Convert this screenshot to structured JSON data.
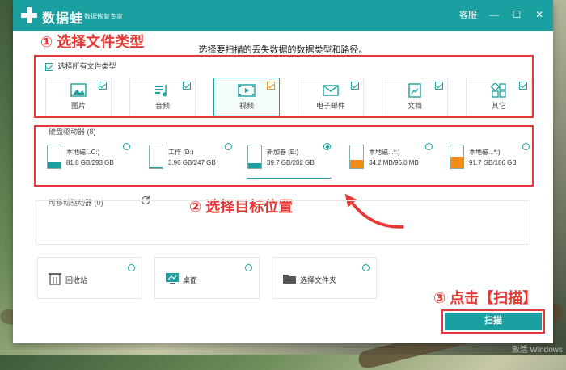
{
  "app": {
    "name": "数据蛙",
    "subtitle": "数据恢复专家"
  },
  "titlebar": {
    "service": "客服",
    "minimize": "—",
    "maximize": "☐",
    "close": "✕"
  },
  "annotations": {
    "step1": "① 选择文件类型",
    "step2": "② 选择目标位置",
    "step3": "③ 点击【扫描】"
  },
  "instruction": "选择要扫描的丢失数据的数据类型和路径。",
  "file_types": {
    "select_all_label": "选择所有文件类型",
    "items": [
      {
        "label": "图片",
        "icon": "image-icon",
        "checked": true
      },
      {
        "label": "音频",
        "icon": "audio-icon",
        "checked": true
      },
      {
        "label": "视频",
        "icon": "video-icon",
        "checked": true,
        "selected": true
      },
      {
        "label": "电子邮件",
        "icon": "email-icon",
        "checked": true
      },
      {
        "label": "文档",
        "icon": "document-icon",
        "checked": true
      },
      {
        "label": "其它",
        "icon": "other-icon",
        "checked": true
      }
    ]
  },
  "hard_drives": {
    "title": "硬盘驱动器 (8)",
    "items": [
      {
        "name": "本地磁...C:)",
        "size": "81.8 GB/293 GB",
        "fill": 0.28,
        "color": "#1aa0a0",
        "selected": false
      },
      {
        "name": "工作 (D:)",
        "size": "3.96 GB/247 GB",
        "fill": 0.02,
        "color": "#1aa0a0",
        "selected": false
      },
      {
        "name": "新加卷 (E:)",
        "size": "39.7 GB/202 GB",
        "fill": 0.2,
        "color": "#1aa0a0",
        "selected": true
      },
      {
        "name": "本地磁...*:)",
        "size": "34.2 MB/96.0 MB",
        "fill": 0.36,
        "color": "#ef8c1a",
        "selected": false
      },
      {
        "name": "本地磁...*:)",
        "size": "91.7 GB/186 GB",
        "fill": 0.49,
        "color": "#ef8c1a",
        "selected": false
      }
    ]
  },
  "removable": {
    "title": "可移动驱动器 (0)",
    "refresh_icon": "refresh-icon"
  },
  "locations": [
    {
      "label": "回收站",
      "icon": "recycle-bin-icon"
    },
    {
      "label": "桌面",
      "icon": "desktop-icon"
    },
    {
      "label": "选择文件夹",
      "icon": "folder-icon"
    }
  ],
  "scan_button": "扫描",
  "watermark": "激活 Windows"
}
